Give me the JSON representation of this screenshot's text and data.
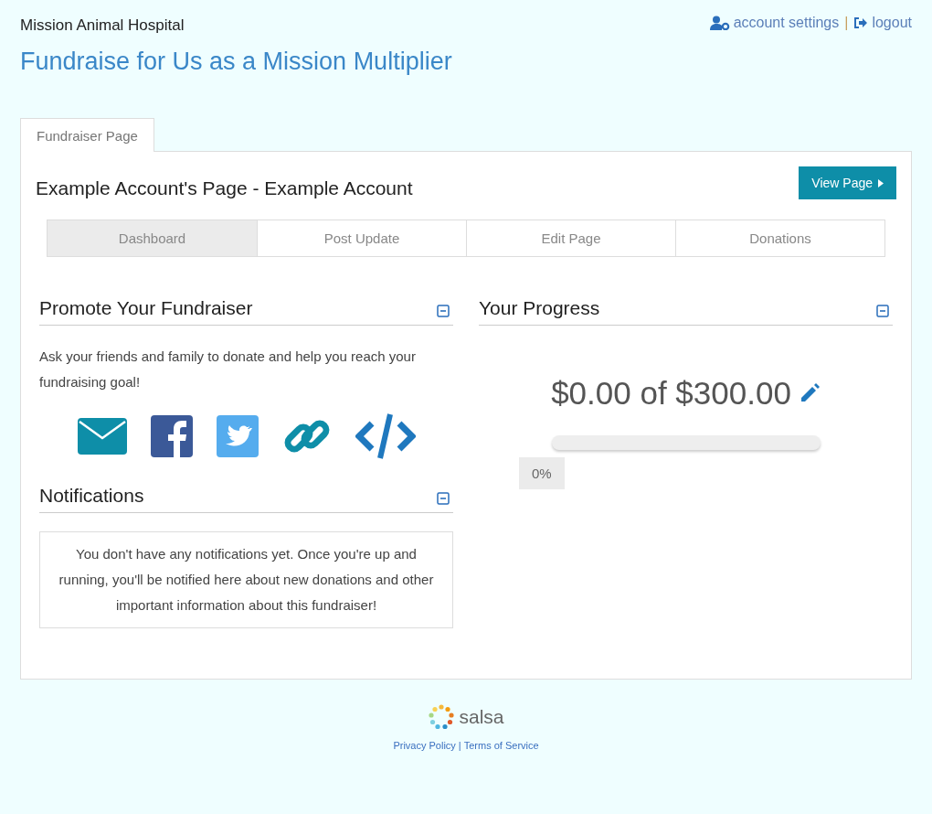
{
  "header": {
    "org": "Mission Animal Hospital",
    "title": "Fundraise for Us as a Mission Multiplier",
    "links": [
      "account settings",
      "logout"
    ],
    "separator": "|"
  },
  "tabs": [
    {
      "label": "Fundraiser Page",
      "selected": true
    }
  ],
  "page": {
    "heading": "Example Account's Page - Example Account",
    "view_button": "View Page"
  },
  "subnav": [
    {
      "label": "Dashboard",
      "selected": true
    },
    {
      "label": "Post Update",
      "selected": false
    },
    {
      "label": "Edit Page",
      "selected": false
    },
    {
      "label": "Donations",
      "selected": false
    }
  ],
  "promote": {
    "title": "Promote Your Fundraiser",
    "expanded": true,
    "text": "Ask your friends and family to donate and help you reach your fundraising goal!"
  },
  "notifications": {
    "title": "Notifications",
    "expanded": true,
    "text": "You don't have any notifications yet. Once you're up and running, you'll be notified here about new donations and other important information about this fundraiser!"
  },
  "progress": {
    "title": "Your Progress",
    "expanded": true,
    "amount": "$0.00 of $300.00",
    "level": 0,
    "percent": "0%"
  },
  "footer": {
    "brand": "salsa",
    "links": [
      "Privacy Policy",
      "Terms of Service"
    ],
    "separator": "|"
  }
}
